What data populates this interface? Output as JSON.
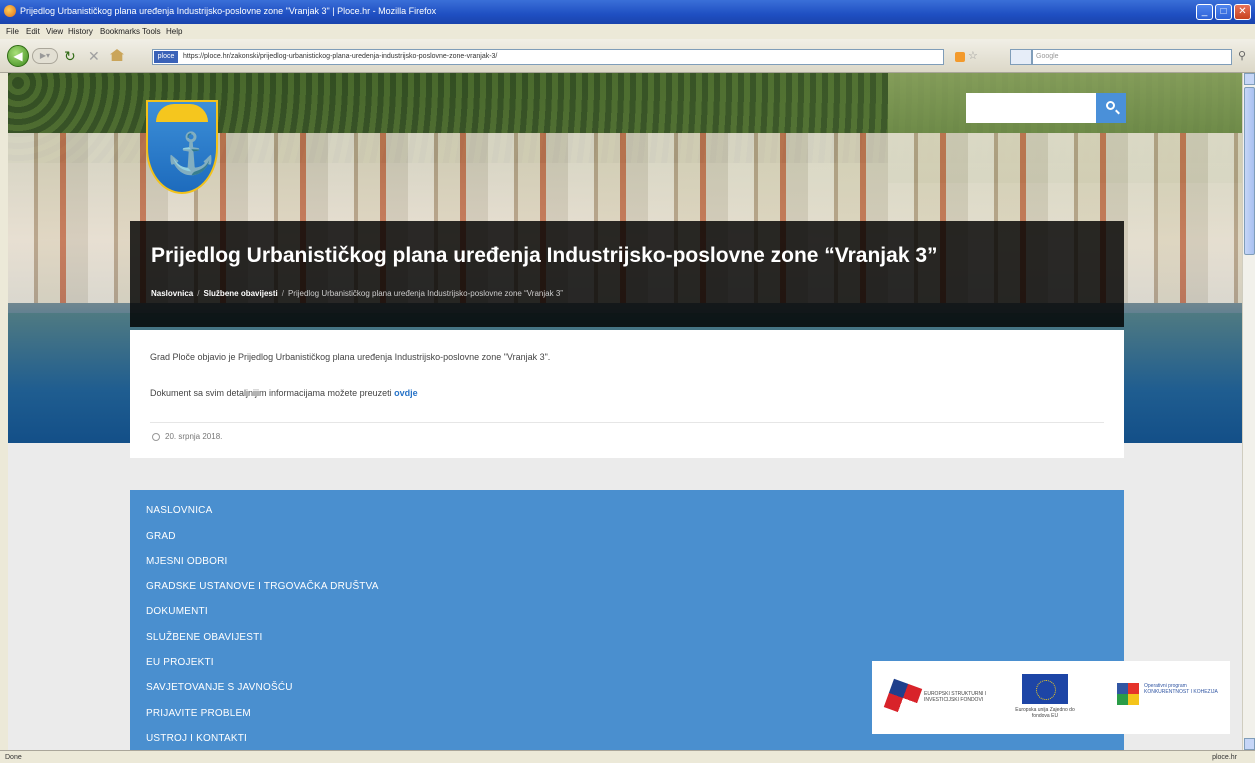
{
  "window": {
    "title": "Prijedlog Urbanističkog plana uređenja Industrijsko-poslovne zone \"Vranjak 3\" | Ploce.hr - Mozilla Firefox"
  },
  "menubar": {
    "items": [
      "File",
      "Edit",
      "View",
      "History",
      "Bookmarks",
      "Tools",
      "Help"
    ]
  },
  "navbar": {
    "site_badge": "ploce",
    "url": "https://ploce.hr/zakonski/prijedlog-urbanistickog-plana-uredenja-industrijsko-poslovne-zone-vranjak-3/",
    "search_placeholder": "Google"
  },
  "site": {
    "search_placeholder": ""
  },
  "page": {
    "title": "Prijedlog Urbanističkog plana uređenja Industrijsko-poslovne zone “Vranjak 3”",
    "breadcrumb": {
      "home": "Naslovnica",
      "section": "Službene obavijesti",
      "current": "Prijedlog Urbanističkog plana uređenja Industrijsko-poslovne zone “Vranjak 3”"
    },
    "body_p1": "Grad Ploče objavio je Prijedlog Urbanističkog plana uređenja Industrijsko-poslovne zone \"Vranjak 3\".",
    "body_p2_prefix": "Dokument sa svim detaljnijim informacijama možete preuzeti",
    "body_p2_link": "ovdje",
    "date": "20. srpnja 2018."
  },
  "menu": {
    "items": [
      "NASLOVNICA",
      "GRAD",
      "MJESNI ODBORI",
      "GRADSKE USTANOVE I TRGOVAČKA DRUŠTVA",
      "DOKUMENTI",
      "SLUŽBENE OBAVIJESTI",
      "EU PROJEKTI",
      "SAVJETOVANJE S JAVNOŠĆU",
      "PRIJAVITE PROBLEM",
      "USTROJ I KONTAKTI"
    ]
  },
  "partners": {
    "logo1_text": "EUROPSKI STRUKTURNI I INVESTICIJSKI FONDOVI",
    "eu_text": "Europska unija Zajedno do fondova EU",
    "logo3_text": "Operativni program KONKURENTNOST I KOHEZIJA"
  },
  "statusbar": {
    "left": "Done",
    "right": "ploce.hr"
  },
  "colors": {
    "accent_blue": "#4a8fcf",
    "title_band": "#000000",
    "link": "#2874c8"
  }
}
